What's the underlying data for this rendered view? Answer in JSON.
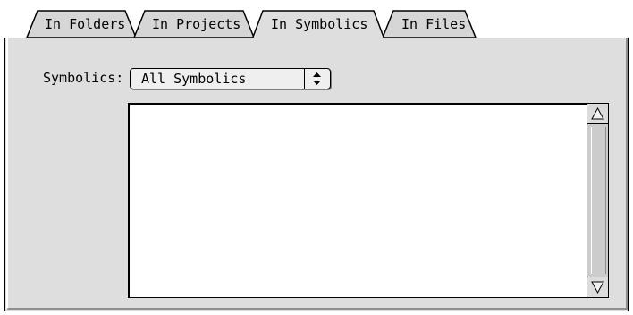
{
  "tabs": [
    {
      "label": "In Folders",
      "selected": false
    },
    {
      "label": "In Projects",
      "selected": false
    },
    {
      "label": "In Symbolics",
      "selected": true
    },
    {
      "label": "In Files",
      "selected": false
    }
  ],
  "search": {
    "label": "Symbolics:",
    "popup_value": "All Symbolics"
  },
  "symbol_list": {
    "items": []
  },
  "colors": {
    "panel": "#dedede",
    "list_background": "#ffffff",
    "border": "#000000"
  },
  "icons": {
    "popup": "up-down-arrows-icon",
    "scroll_up": "scroll-up-arrow-icon",
    "scroll_down": "scroll-down-arrow-icon"
  }
}
